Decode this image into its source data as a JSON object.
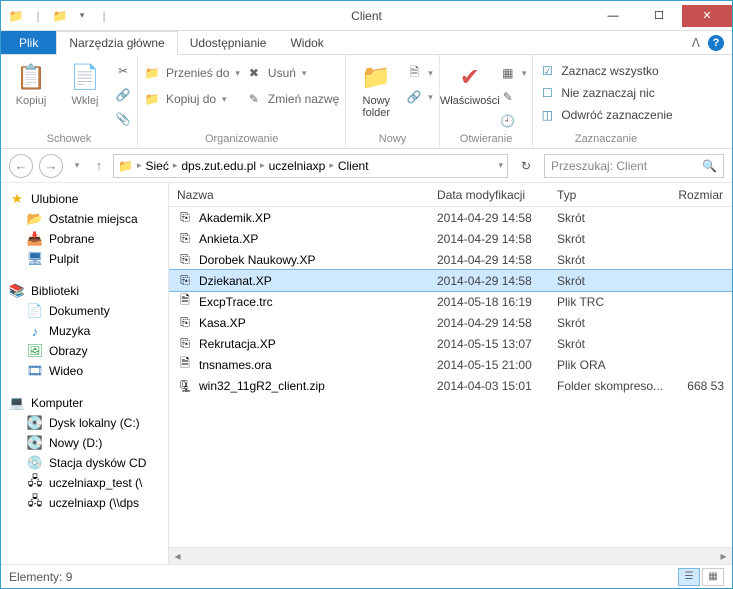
{
  "title": "Client",
  "tabs": {
    "file": "Plik",
    "home": "Narzędzia główne",
    "share": "Udostępnianie",
    "view": "Widok"
  },
  "ribbon": {
    "clipboard": {
      "copy": "Kopiuj",
      "paste": "Wklej",
      "label": "Schowek"
    },
    "organize": {
      "moveto": "Przenieś do",
      "copyto": "Kopiuj do",
      "delete": "Usuń",
      "rename": "Zmień nazwę",
      "label": "Organizowanie"
    },
    "new": {
      "folder": "Nowy\nfolder",
      "label": "Nowy"
    },
    "open": {
      "props": "Właściwości",
      "label": "Otwieranie"
    },
    "select": {
      "all": "Zaznacz wszystko",
      "none": "Nie zaznaczaj nic",
      "invert": "Odwróć zaznaczenie",
      "label": "Zaznaczanie"
    }
  },
  "breadcrumb": [
    "Sieć",
    "dps.zut.edu.pl",
    "uczelniaxp",
    "Client"
  ],
  "search_placeholder": "Przeszukaj: Client",
  "sidebar": {
    "favorites": {
      "label": "Ulubione",
      "items": [
        "Ostatnie miejsca",
        "Pobrane",
        "Pulpit"
      ]
    },
    "libraries": {
      "label": "Biblioteki",
      "items": [
        "Dokumenty",
        "Muzyka",
        "Obrazy",
        "Wideo"
      ]
    },
    "computer": {
      "label": "Komputer",
      "items": [
        "Dysk lokalny (C:)",
        "Nowy (D:)",
        "Stacja dysków CD",
        "uczelniaxp_test (\\",
        "uczelniaxp (\\\\dps"
      ]
    }
  },
  "columns": {
    "name": "Nazwa",
    "date": "Data modyfikacji",
    "type": "Typ",
    "size": "Rozmiar"
  },
  "files": [
    {
      "name": "Akademik.XP",
      "date": "2014-04-29 14:58",
      "type": "Skrót",
      "size": "",
      "icon": "shortcut"
    },
    {
      "name": "Ankieta.XP",
      "date": "2014-04-29 14:58",
      "type": "Skrót",
      "size": "",
      "icon": "shortcut"
    },
    {
      "name": "Dorobek Naukowy.XP",
      "date": "2014-04-29 14:58",
      "type": "Skrót",
      "size": "",
      "icon": "shortcut"
    },
    {
      "name": "Dziekanat.XP",
      "date": "2014-04-29 14:58",
      "type": "Skrót",
      "size": "",
      "icon": "shortcut",
      "selected": true
    },
    {
      "name": "ExcpTrace.trc",
      "date": "2014-05-18 16:19",
      "type": "Plik TRC",
      "size": "",
      "icon": "file"
    },
    {
      "name": "Kasa.XP",
      "date": "2014-04-29 14:58",
      "type": "Skrót",
      "size": "",
      "icon": "shortcut"
    },
    {
      "name": "Rekrutacja.XP",
      "date": "2014-05-15 13:07",
      "type": "Skrót",
      "size": "",
      "icon": "shortcut"
    },
    {
      "name": "tnsnames.ora",
      "date": "2014-05-15 21:00",
      "type": "Plik ORA",
      "size": "",
      "icon": "file"
    },
    {
      "name": "win32_11gR2_client.zip",
      "date": "2014-04-03 15:01",
      "type": "Folder skompreso...",
      "size": "668 53",
      "icon": "zip"
    }
  ],
  "status": "Elementy: 9"
}
